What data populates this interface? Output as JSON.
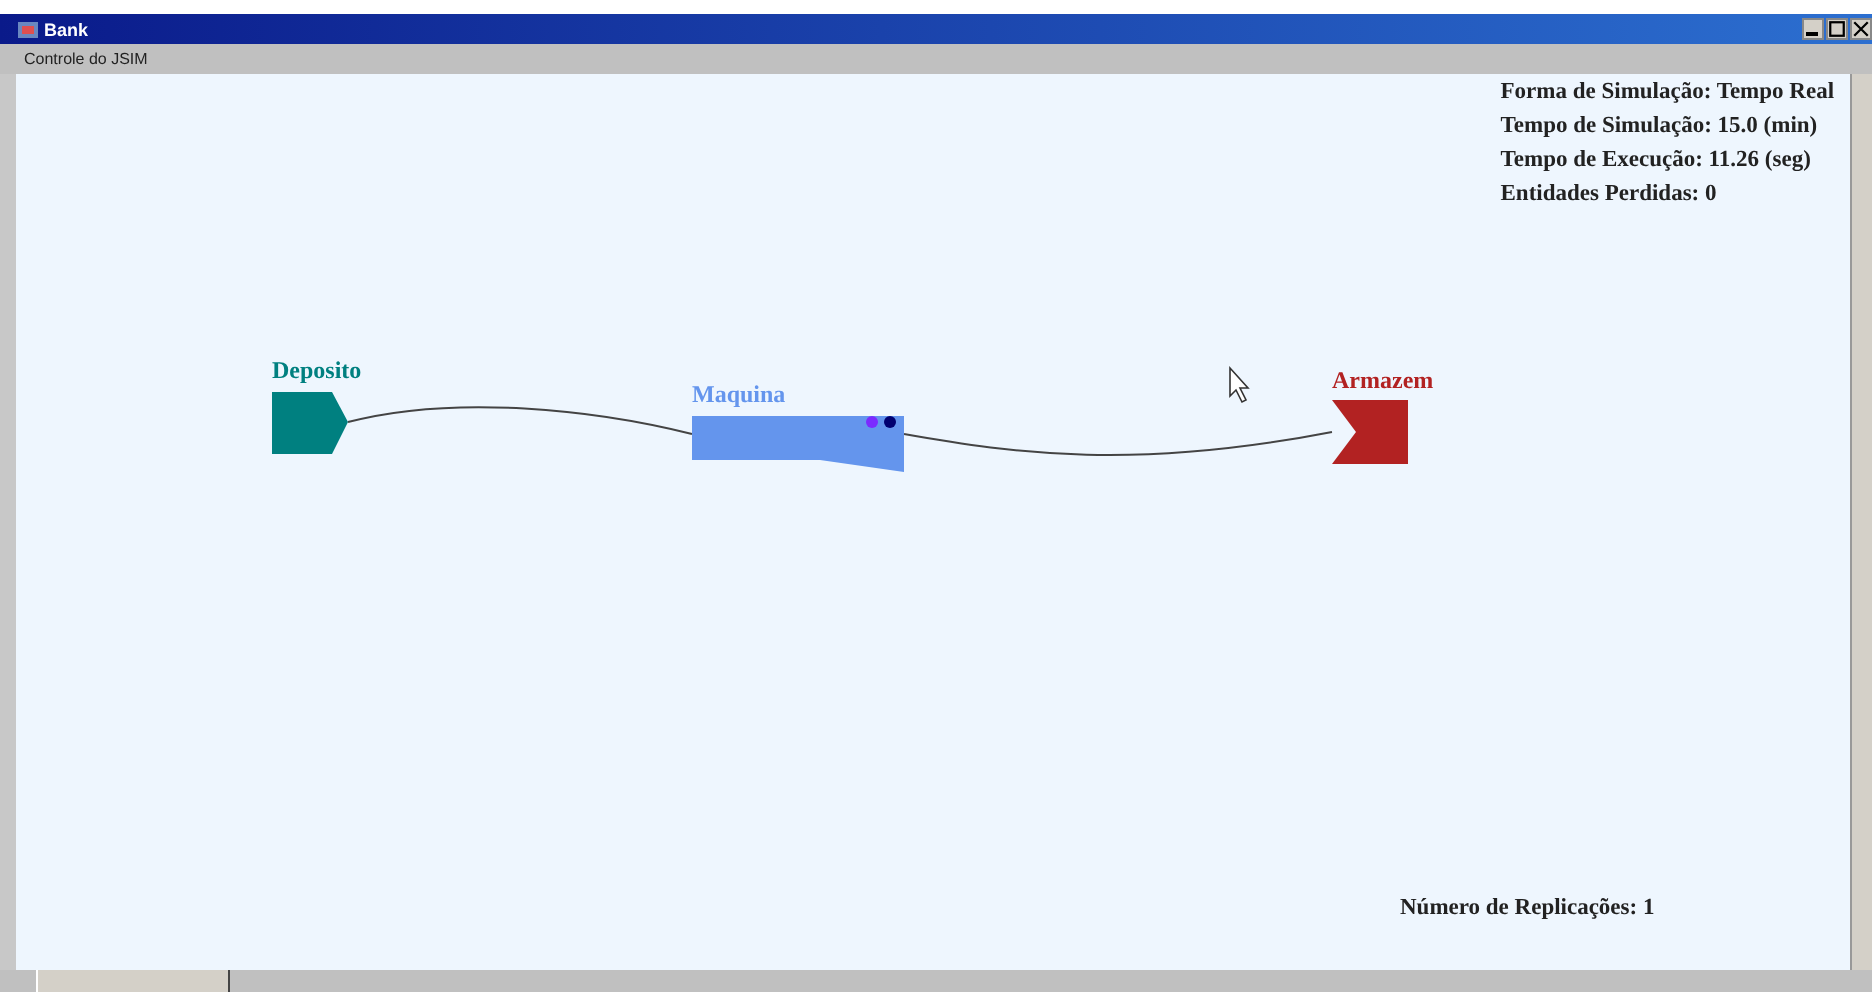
{
  "window": {
    "title": "Bank"
  },
  "menu": [
    "Controle do JSIM"
  ],
  "stats": [
    {
      "label": "Forma de Simulação:",
      "value": "Tempo Real"
    },
    {
      "label": "Tempo de Simulação:",
      "value": "15.0 (min)"
    },
    {
      "label": "Tempo de Execução:",
      "value": "11.26 (seg)"
    },
    {
      "label": "Entidades Perdidas:",
      "value": "0"
    }
  ],
  "nodes": [
    {
      "kind": "source",
      "label": "Deposito",
      "color": "#008080"
    },
    {
      "kind": "server",
      "label": "Maquina",
      "color": "#6495ed",
      "entities": [
        {
          "color": "#7b2bff"
        },
        {
          "color": "#000070"
        }
      ]
    },
    {
      "kind": "sink",
      "label": "Armazem",
      "color": "#b22222"
    }
  ],
  "replications": {
    "label": "Número de Replicações:",
    "value": "1"
  }
}
